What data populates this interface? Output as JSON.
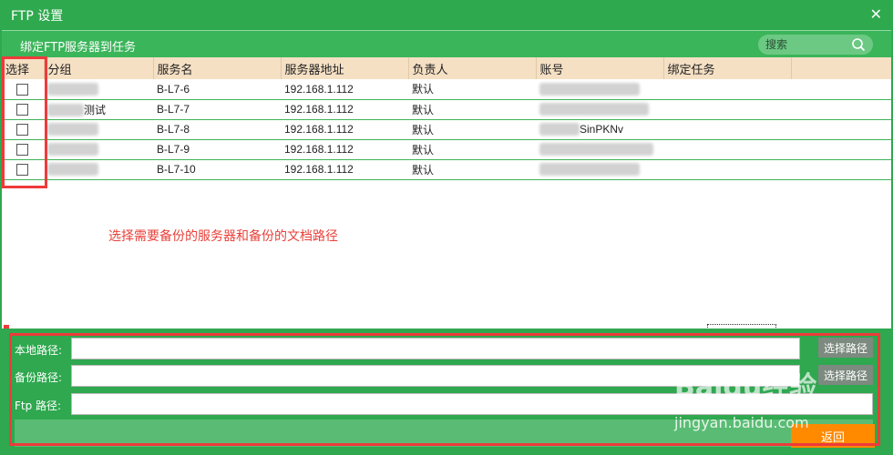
{
  "window": {
    "title": "FTP 设置",
    "close_label": "✕"
  },
  "subbar": {
    "label": "绑定FTP服务器到任务",
    "search_placeholder": "搜索"
  },
  "table": {
    "headers": [
      "选择",
      "分组",
      "服务名",
      "服务器地址",
      "负责人",
      "账号",
      "绑定任务"
    ],
    "rows": [
      {
        "group": "",
        "service": "B-L7-6",
        "address": "192.168.1.112",
        "owner": "默认",
        "account": "",
        "task": ""
      },
      {
        "group": "测试",
        "service": "B-L7-7",
        "address": "192.168.1.112",
        "owner": "默认",
        "account": "",
        "task": ""
      },
      {
        "group": "",
        "service": "B-L7-8",
        "address": "192.168.1.112",
        "owner": "默认",
        "account": "SinPKNv",
        "task": ""
      },
      {
        "group": "",
        "service": "B-L7-9",
        "address": "192.168.1.112",
        "owner": "默认",
        "account": "",
        "task": ""
      },
      {
        "group": "",
        "service": "B-L7-10",
        "address": "192.168.1.112",
        "owner": "默认",
        "account": "",
        "task": ""
      }
    ]
  },
  "annotation": "选择需要备份的服务器和备份的文档路径",
  "form": {
    "local_label": "本地路径:",
    "backup_label": "备份路径:",
    "ftp_label": "Ftp 路径:",
    "choose_path_label": "选择路径",
    "back_label": "返回"
  },
  "watermark": {
    "logo": "Baidu经验",
    "url": "jingyan.baidu.com"
  },
  "colors": {
    "primary_green": "#2fa84f",
    "header_bg": "#f5e0c4",
    "annotation_red": "#e8413a",
    "back_orange": "#ff8a00"
  }
}
